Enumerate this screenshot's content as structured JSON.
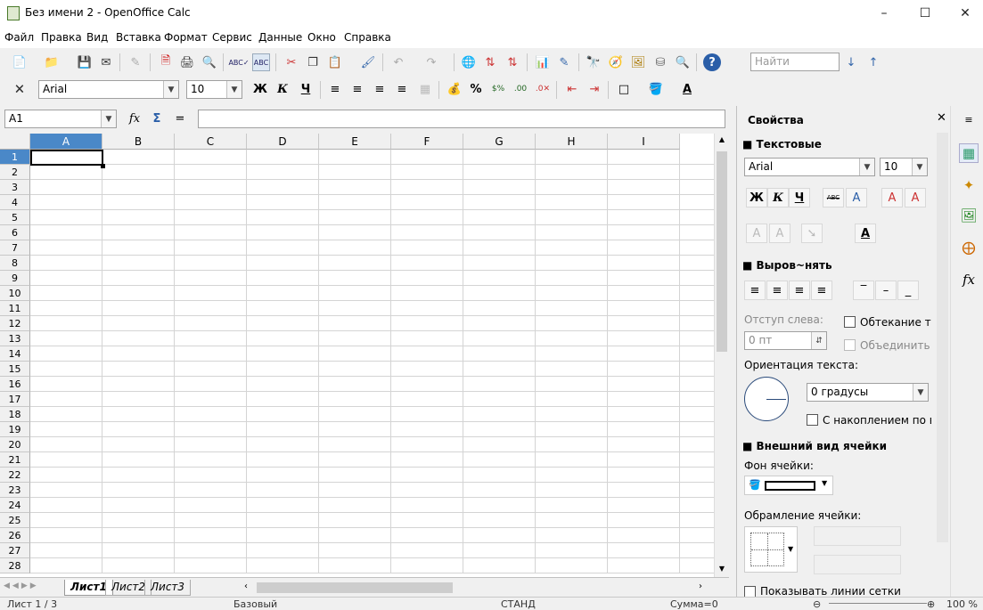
{
  "window": {
    "title": "Без имени 2 - OpenOffice Calc"
  },
  "menu": [
    "Файл",
    "Правка",
    "Вид",
    "Вставка",
    "Формат",
    "Сервис",
    "Данные",
    "Окно",
    "Справка"
  ],
  "search": {
    "placeholder": "Найти"
  },
  "format": {
    "font": "Arial",
    "size": "10",
    "bold": "Ж",
    "italic": "К",
    "underline": "Ч"
  },
  "formula": {
    "cell_ref": "A1",
    "fx": "fx",
    "sum": "Σ",
    "equals": "=",
    "value": ""
  },
  "columns": [
    "A",
    "B",
    "C",
    "D",
    "E",
    "F",
    "G",
    "H",
    "I"
  ],
  "rows": [
    "1",
    "2",
    "3",
    "4",
    "5",
    "6",
    "7",
    "8",
    "9",
    "10",
    "11",
    "12",
    "13",
    "14",
    "15",
    "16",
    "17",
    "18",
    "19",
    "20",
    "21",
    "22",
    "23",
    "24",
    "25",
    "26",
    "27",
    "28"
  ],
  "sheets": [
    "Лист1",
    "Лист2",
    "Лист3"
  ],
  "status": {
    "sheet": "Лист 1 / 3",
    "style": "Базовый",
    "mode": "СТАНД",
    "sum": "Сумма=0",
    "zoom": "100 %"
  },
  "sidebar": {
    "title": "Свойства",
    "text_section": "Текстовые",
    "font": "Arial",
    "size": "10",
    "bold": "Ж",
    "italic": "К",
    "underline": "Ч",
    "strike": "ABC",
    "align_section": "Выров~нять",
    "indent_label": "Отступ слева:",
    "indent_value": "0 пт",
    "wrap_label": "Обтекание тек",
    "merge_label": "Объединить я",
    "orientation_label": "Ориентация текста:",
    "degrees": "0 градусы",
    "stack_label": "С накоплением по вер",
    "appearance_section": "Внешний вид ячейки",
    "bg_label": "Фон ячейки:",
    "border_label": "Обрамление ячейки:",
    "gridlines_label": "Показывать линии сетки"
  }
}
